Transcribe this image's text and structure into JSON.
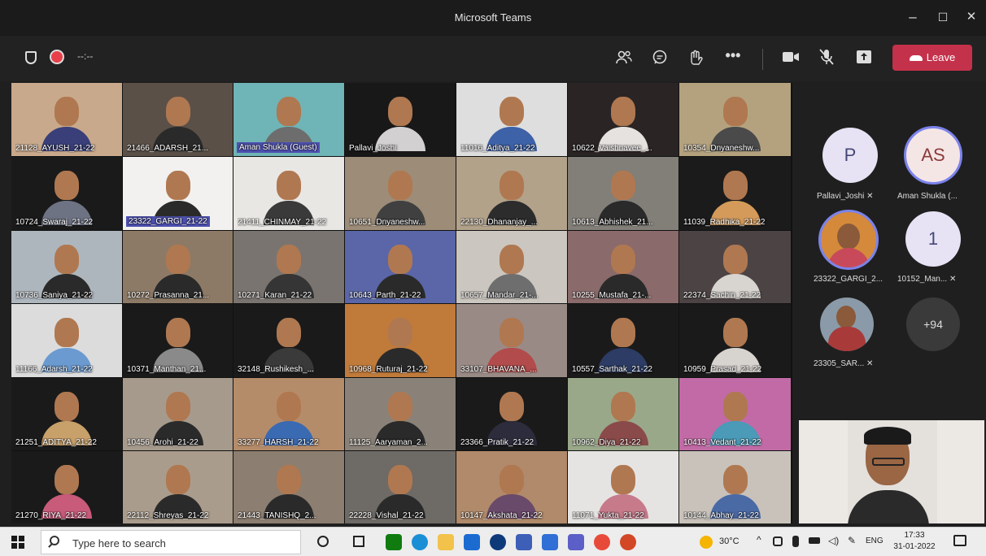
{
  "window": {
    "title": "Microsoft Teams",
    "minimize": "–",
    "maximize": "☐",
    "close": "✕"
  },
  "toolbar": {
    "timer": "--:--",
    "leave_label": "Leave"
  },
  "participants": [
    {
      "name": "21128_AYUSH_21-22 ",
      "bg": "#c9a98c",
      "shirt": "#3a3f7a"
    },
    {
      "name": "21466_ADARSH_21...",
      "bg": "#5a5048",
      "shirt": "#2a2a2a"
    },
    {
      "name": "Aman Shukla (Guest)",
      "bg": "#6fb4b6",
      "shirt": "#6d6d6d"
    },
    {
      "name": "Pallavi_Joshi",
      "bg": "#181818",
      "shirt": "#d2d0d0"
    },
    {
      "name": "11016_Aditya_21-22",
      "bg": "#dedede",
      "shirt": "#3e62a8"
    },
    {
      "name": "10622_Vaishnavee_...",
      "bg": "#2a2524",
      "shirt": "#e6e2df"
    },
    {
      "name": "10354_Dnyaneshw...",
      "bg": "#b4a27f",
      "shirt": "#4a4a4a"
    },
    {
      "name": "10724_Swaraj_21-22",
      "bg": "#1a1a1a",
      "shirt": "#6e7384"
    },
    {
      "name": "23322_GARGI_21-22",
      "bg": "#f2f1ef",
      "shirt": "#2a2a2a"
    },
    {
      "name": "21411_CHINMAY_21-22",
      "bg": "#e9e7e4",
      "shirt": "#3a3a3a"
    },
    {
      "name": "10651_Dnyaneshw...",
      "bg": "#9c8c78",
      "shirt": "#404040"
    },
    {
      "name": "22130_Dhananjay_...",
      "bg": "#b2a28a",
      "shirt": "#2c2c2c"
    },
    {
      "name": "10613_Abhishek_21...",
      "bg": "#827e78",
      "shirt": "#2a2a2a"
    },
    {
      "name": "11039_Radhika_21-22",
      "bg": "#1b1b1b",
      "shirt": "#d49a5a"
    },
    {
      "name": "10736_Saniya_21-22",
      "bg": "#aeb6bd",
      "shirt": "#2a2a2a"
    },
    {
      "name": "10272_Prasanna_21...",
      "bg": "#8d7a66",
      "shirt": "#2a2a2a"
    },
    {
      "name": "10271_Karan_21-22",
      "bg": "#7a7470",
      "shirt": "#353535"
    },
    {
      "name": "10643_Parth_21-22",
      "bg": "#5a66a8",
      "shirt": "#2a2a2a"
    },
    {
      "name": "10657_Mandar_21-...",
      "bg": "#cbc6bf",
      "shirt": "#6e6e6e"
    },
    {
      "name": "10255_Mustafa_21-...",
      "bg": "#8a6a6a",
      "shirt": "#2a2a2a"
    },
    {
      "name": "22374_Sachin_21-22",
      "bg": "#4c4444",
      "shirt": "#d8d4cf"
    },
    {
      "name": "11166_Adarsh_21-22",
      "bg": "#dcdcdc",
      "shirt": "#6a9ad0"
    },
    {
      "name": "10371_Manthan_21...",
      "bg": "#1a1a1a",
      "shirt": "#8a8a8a"
    },
    {
      "name": "32148_Rushikesh_...",
      "bg": "#1a1a1a",
      "shirt": "#3a3a3a"
    },
    {
      "name": "10968_Ruturaj_21-22",
      "bg": "#c07a3a",
      "shirt": "#2a2a2a"
    },
    {
      "name": "33107_BHAVANA_...",
      "bg": "#9a8a86",
      "shirt": "#b24b4b"
    },
    {
      "name": "10557_Sarthak_21-22",
      "bg": "#1a1a1a",
      "shirt": "#2c3c64"
    },
    {
      "name": "10959_Prasad_21-22",
      "bg": "#1a1a1a",
      "shirt": "#d7d3cf"
    },
    {
      "name": "21251_ADITYA_21-22",
      "bg": "#1a1a1a",
      "shirt": "#c8a06a"
    },
    {
      "name": "10456_Arohi_21-22",
      "bg": "#a69a8c",
      "shirt": "#2a2a2a"
    },
    {
      "name": "33277_HARSH_21-22",
      "bg": "#b58c6a",
      "shirt": "#3a6ab2"
    },
    {
      "name": "11125_Aaryaman_2...",
      "bg": "#8a8278",
      "shirt": "#2a2a2a"
    },
    {
      "name": "23366_Pratik_21-22",
      "bg": "#1a1a1a",
      "shirt": "#2c2c3c"
    },
    {
      "name": "10962_Diya_21-22",
      "bg": "#9aa88a",
      "shirt": "#8a4a4a"
    },
    {
      "name": "10413_Vedant_21-22",
      "bg": "#c26aa6",
      "shirt": "#4a9ab8"
    },
    {
      "name": "21270_RIYA_21-22",
      "bg": "#1a1a1a",
      "shirt": "#c85a7a"
    },
    {
      "name": "22112_Shreyas_21-22",
      "bg": "#aa9c8c",
      "shirt": "#2a2a2a"
    },
    {
      "name": "21443_TANISHQ_2...",
      "bg": "#8c7e70",
      "shirt": "#2a2a2a"
    },
    {
      "name": "22228_Vishal_21-22",
      "bg": "#6e6a66",
      "shirt": "#2a2a2a"
    },
    {
      "name": "10147_Akshata_21-22",
      "bg": "#b08a6a",
      "shirt": "#6a4a6a"
    },
    {
      "name": "11071_Yukta_21-22",
      "bg": "#e6e4e2",
      "shirt": "#c67a8a"
    },
    {
      "name": "10144_Abhay_21-22",
      "bg": "#c8c2ba",
      "shirt": "#4a6aa6"
    }
  ],
  "sidebar": {
    "people": [
      {
        "initials": "P",
        "name": "Pallavi_Joshi"
      },
      {
        "initials": "AS",
        "name": "Aman Shukla (..."
      },
      {
        "initials": "",
        "name": "23322_GARGI_2..."
      },
      {
        "initials": "1",
        "name": "10152_Man..."
      },
      {
        "initials": "",
        "name": "23305_SAR..."
      }
    ],
    "overflow": "+94"
  },
  "taskbar": {
    "search_placeholder": "Type here to search",
    "weather": "30°C",
    "lang": "ENG",
    "time": "17:33",
    "date": "31-01-2022"
  }
}
